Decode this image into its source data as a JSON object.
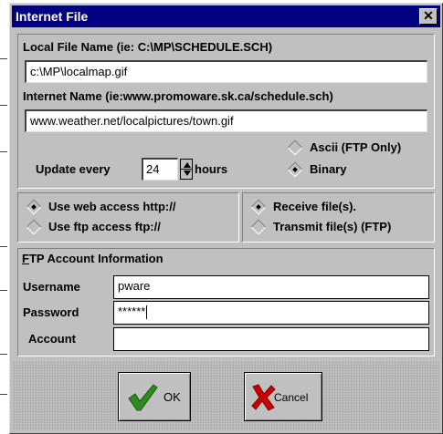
{
  "window": {
    "title": "Internet File",
    "close_glyph": "✕"
  },
  "local_file": {
    "label": "Local File Name (ie: C:\\MP\\SCHEDULE.SCH)",
    "value": "c:\\MP\\localmap.gif"
  },
  "internet_name": {
    "label": "Internet Name (ie:www.promoware.sk.ca/schedule.sch)",
    "value": "www.weather.net/localpictures/town.gif"
  },
  "update": {
    "label": "Update every",
    "value": "24",
    "unit": "hours"
  },
  "transfer_mode": {
    "options": [
      {
        "label": "Ascii (FTP Only)",
        "selected": false
      },
      {
        "label": "Binary",
        "selected": true
      }
    ]
  },
  "access": {
    "options": [
      {
        "label": "Use web access http://",
        "selected": true
      },
      {
        "label": "Use ftp access ftp://",
        "selected": false
      }
    ]
  },
  "direction": {
    "options": [
      {
        "label": "Receive file(s).",
        "selected": true
      },
      {
        "label": "Transmit file(s) (FTP)",
        "selected": false
      }
    ]
  },
  "ftp_account": {
    "header_prefix": "F",
    "header_rest": "TP Account Information",
    "username": {
      "label": "Username",
      "value": "pware"
    },
    "password": {
      "label": "Password",
      "value": "******"
    },
    "account": {
      "label": "Account",
      "value": ""
    }
  },
  "buttons": {
    "ok": {
      "label": "OK",
      "icon": "checkmark-icon",
      "icon_color": "#2e8b1e"
    },
    "cancel": {
      "label": "Cancel",
      "icon": "x-icon",
      "icon_color": "#cc0000"
    }
  }
}
